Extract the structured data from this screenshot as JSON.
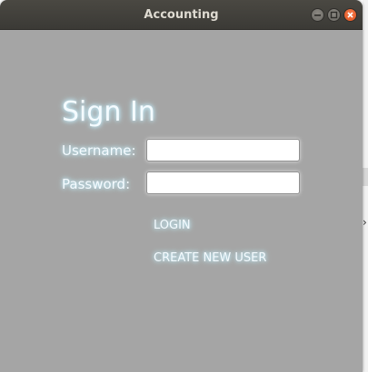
{
  "window": {
    "title": "Accounting",
    "controls": {
      "minimize": "minimize-icon",
      "maximize": "maximize-icon",
      "close": "close-icon"
    }
  },
  "form": {
    "heading": "Sign In",
    "username_label": "Username:",
    "username_value": "",
    "password_label": "Password:",
    "password_value": "",
    "login_label": "LOGIN",
    "create_user_label": "CREATE NEW USER"
  },
  "colors": {
    "titlebar": "#3b3a36",
    "window_body": "#a5a5a5",
    "text_glow": "#cdf3ff",
    "close_button": "#e0541f"
  }
}
